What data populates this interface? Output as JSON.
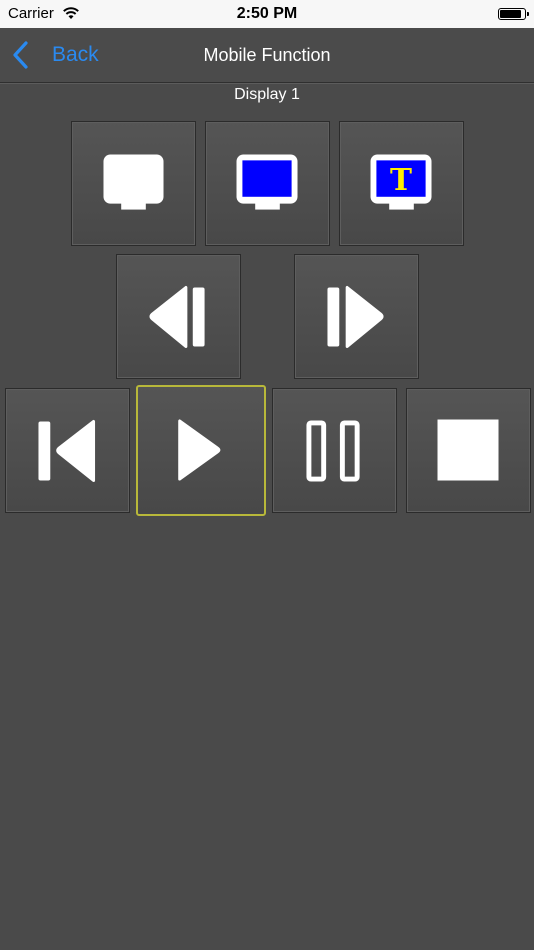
{
  "status_bar": {
    "carrier": "Carrier",
    "time": "2:50 PM",
    "battery_level": 0.9
  },
  "nav": {
    "back_label": "Back",
    "title": "Mobile Function",
    "back_color": "#2a8af0"
  },
  "display_label": "Display 1",
  "buttons": {
    "display_off": {
      "icon": "monitor-white-icon"
    },
    "display_blue": {
      "icon": "monitor-blue-icon",
      "color": "#0000ff"
    },
    "display_text": {
      "icon": "monitor-text-icon",
      "text": "T",
      "text_color": "#ffee00"
    },
    "step_back": {
      "icon": "step-backward-icon"
    },
    "step_forward": {
      "icon": "step-forward-icon"
    },
    "skip_start": {
      "icon": "skip-to-start-icon"
    },
    "play": {
      "icon": "play-icon",
      "selected": true,
      "selected_color": "#b8b83a"
    },
    "pause": {
      "icon": "pause-icon"
    },
    "stop": {
      "icon": "stop-icon"
    }
  }
}
